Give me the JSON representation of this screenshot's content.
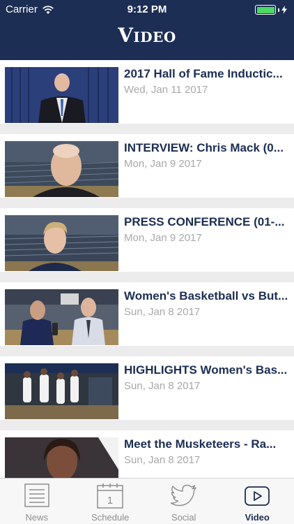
{
  "status": {
    "carrier": "Carrier",
    "time": "9:12 PM"
  },
  "header": {
    "title": "Video"
  },
  "videos": [
    {
      "title": "2017 Hall of Fame Inductic...",
      "date": "Wed, Jan 11 2017"
    },
    {
      "title": "INTERVIEW: Chris Mack (0...",
      "date": "Mon, Jan 9 2017"
    },
    {
      "title": "PRESS CONFERENCE (01-...",
      "date": "Mon, Jan 9 2017"
    },
    {
      "title": "Women's Basketball vs But...",
      "date": "Sun, Jan 8 2017"
    },
    {
      "title": "HIGHLIGHTS Women's Bas...",
      "date": "Sun, Jan 8 2017"
    },
    {
      "title": "Meet the Musketeers - Ra...",
      "date": "Sun, Jan 8 2017"
    }
  ],
  "tabs": [
    {
      "label": "News",
      "icon": "news-icon"
    },
    {
      "label": "Schedule",
      "icon": "calendar-icon",
      "badge": "1"
    },
    {
      "label": "Social",
      "icon": "twitter-icon"
    },
    {
      "label": "Video",
      "icon": "play-icon",
      "active": true
    }
  ],
  "colors": {
    "navy": "#1c2e53",
    "battery": "#4cd964",
    "date": "#a8a8a8"
  }
}
